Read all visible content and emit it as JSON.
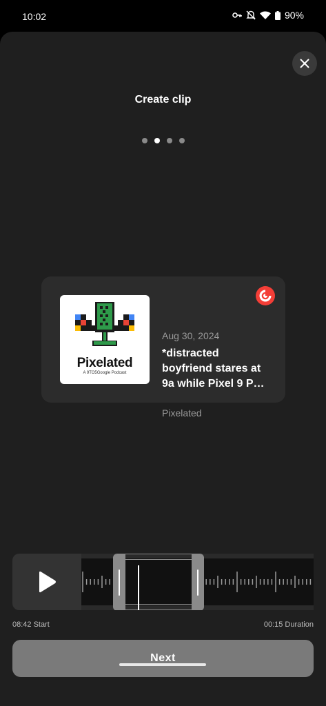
{
  "status_bar": {
    "time": "10:02",
    "battery": "90%",
    "icons": [
      "vpn-key-icon",
      "mute-icon",
      "wifi-icon",
      "battery-icon"
    ]
  },
  "sheet": {
    "title": "Create clip",
    "close_icon": "close-icon",
    "steps": {
      "total": 4,
      "active": 2
    }
  },
  "episode": {
    "date": "Aug 30, 2024",
    "title": "*distracted boyfriend stares at 9a while Pixel 9 P…",
    "show": "Pixelated",
    "artwork": {
      "name": "Pixelated",
      "tagline": "A 9TO5Google Podcast"
    },
    "app_logo": "pocket-casts-logo",
    "logo_color": "#f43e37"
  },
  "clip": {
    "start_label": "08:42 Start",
    "duration_label": "00:15 Duration",
    "play_icon": "play-icon"
  },
  "next_label": "Next",
  "colors": {
    "background": "#1f1f1f",
    "card": "#2c2c2c",
    "button": "#7a7a7a",
    "selection": "#8a8a8a"
  }
}
